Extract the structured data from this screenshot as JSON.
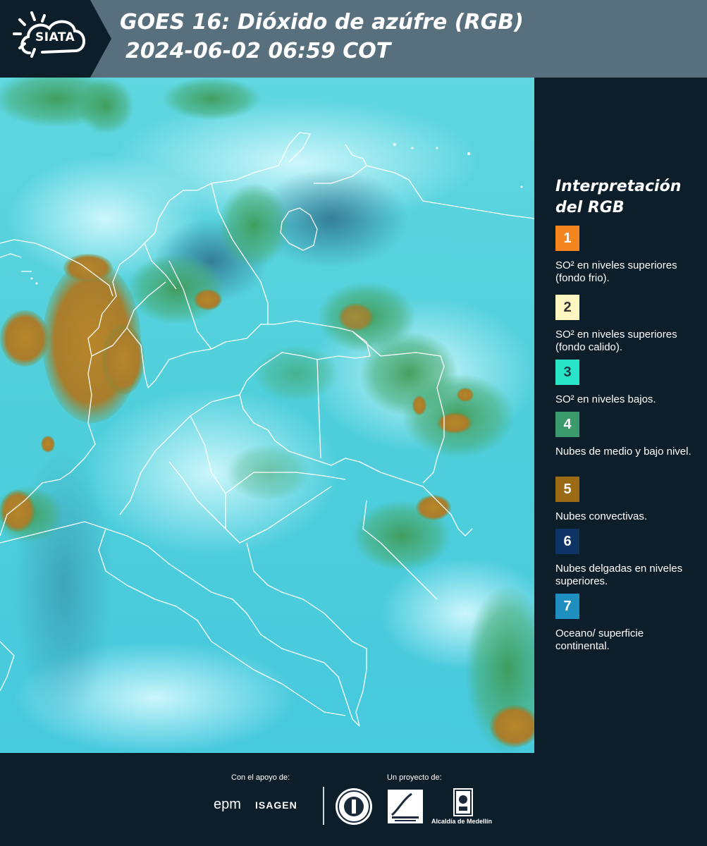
{
  "logo": {
    "text": "SIATA",
    "icon": "sun-cloud-icon"
  },
  "title": {
    "line1": "GOES 16: Dióxido de azúfre (RGB)",
    "line2": "2024-06-02 06:59 COT"
  },
  "legend": {
    "title_line1": "Interpretación",
    "title_line2": "del RGB",
    "items": [
      {
        "number": "1",
        "color": "#f5861f",
        "text_color": "#ffffff",
        "label": "SO² en niveles superiores (fondo frio)."
      },
      {
        "number": "2",
        "color": "#fff7c2",
        "text_color": "#333333",
        "label": "SO² en niveles superiores (fondo calido)."
      },
      {
        "number": "3",
        "color": "#28e5c8",
        "text_color": "#1c3b40",
        "label": "SO² en niveles bajos."
      },
      {
        "number": "4",
        "color": "#3b9a6b",
        "text_color": "#ffffff",
        "label": "Nubes de medio y bajo nivel."
      },
      {
        "number": "5",
        "color": "#9a6a14",
        "text_color": "#ffffff",
        "label": "Nubes convectivas."
      },
      {
        "number": "6",
        "color": "#0e3466",
        "text_color": "#ffffff",
        "label": "Nubes delgadas en niveles superiores."
      },
      {
        "number": "7",
        "color": "#1f8fbf",
        "text_color": "#ffffff",
        "label": "Oceano/ superficie continental."
      }
    ]
  },
  "footer": {
    "support_label": "Con el apoyo de:",
    "project_label": "Un proyecto de:",
    "sponsors": [
      "epm",
      "ISAGEN"
    ],
    "partners": [
      "Alcaldía de Medellín"
    ]
  }
}
